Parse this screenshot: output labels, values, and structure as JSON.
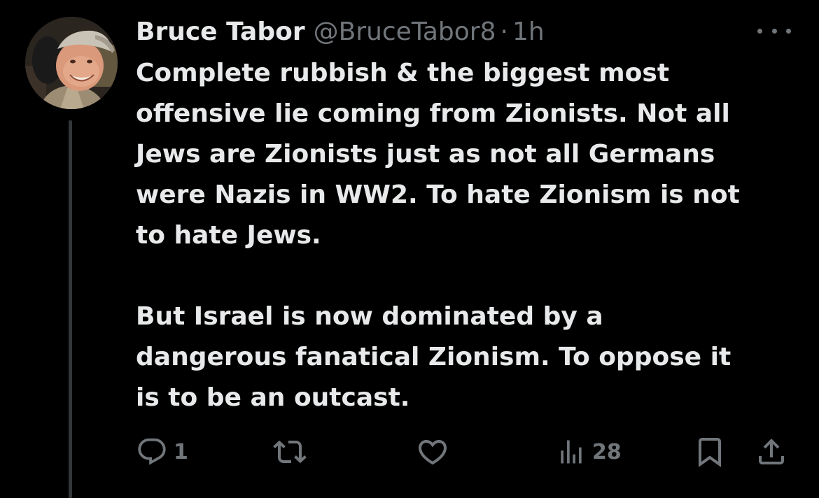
{
  "tweet": {
    "display_name": "Bruce Tabor",
    "handle": "@BruceTabor8",
    "separator": "·",
    "time": "1h",
    "paragraph_1": "Complete rubbish & the biggest most\noffensive lie coming from Zionists. Not all\nJews are Zionists just as not all Germans\nwere Nazis in WW2. To hate Zionism is not\nto hate Jews.",
    "paragraph_2": "But Israel is now dominated by a\ndangerous fanatical Zionism. To oppose it\nis to be an outcast."
  },
  "actions": {
    "reply_count": "1",
    "views_count": "28"
  },
  "icons": {
    "more": "more-horizontal-icon",
    "reply": "reply-icon",
    "retweet": "retweet-icon",
    "like": "heart-icon",
    "views": "views-chart-icon",
    "bookmark": "bookmark-icon",
    "share": "share-icon"
  },
  "colors": {
    "background": "#000000",
    "text_primary": "#e7e9ea",
    "text_secondary": "#71767b",
    "thread_line": "#333639"
  }
}
